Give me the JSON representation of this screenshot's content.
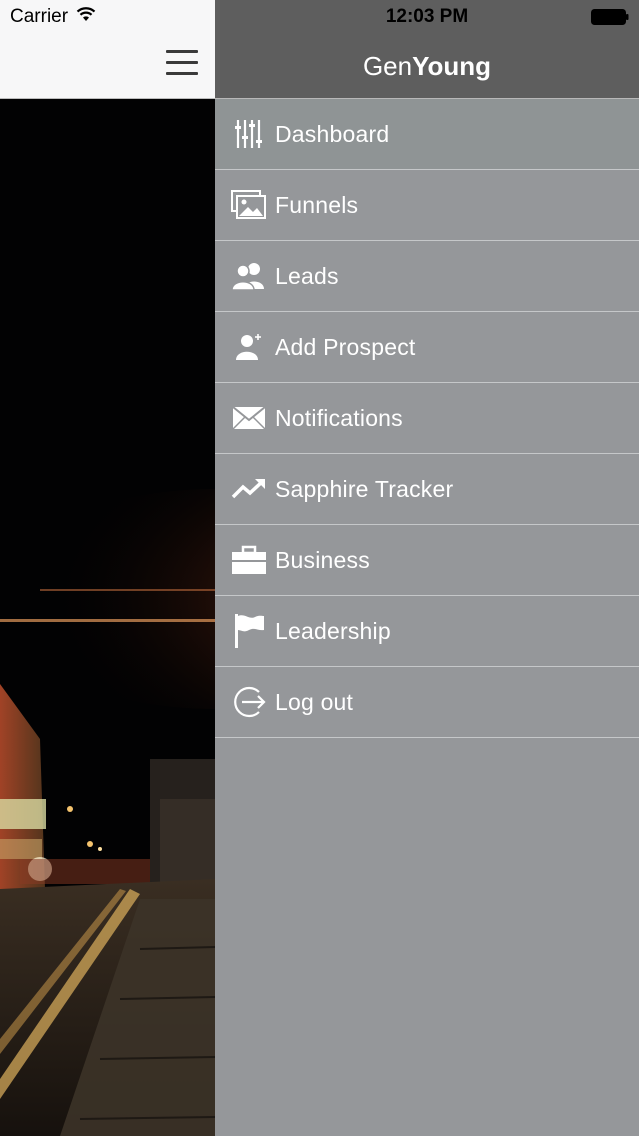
{
  "status_bar": {
    "carrier": "Carrier",
    "time": "12:03 PM",
    "icons": [
      "wifi-icon",
      "battery-icon"
    ]
  },
  "app": {
    "brand_light": "Gen",
    "brand_bold": "Young",
    "menu_icon": "hamburger-menu-icon"
  },
  "menu": {
    "items": [
      {
        "label": "Dashboard",
        "icon": "sliders-icon"
      },
      {
        "label": "Funnels",
        "icon": "images-icon"
      },
      {
        "label": "Leads",
        "icon": "users-icon"
      },
      {
        "label": "Add Prospect",
        "icon": "user-add-icon"
      },
      {
        "label": "Notifications",
        "icon": "envelope-icon"
      },
      {
        "label": "Sapphire Tracker",
        "icon": "trend-up-icon"
      },
      {
        "label": "Business",
        "icon": "briefcase-icon"
      },
      {
        "label": "Leadership",
        "icon": "flag-icon"
      },
      {
        "label": "Log out",
        "icon": "logout-icon"
      }
    ]
  },
  "colors": {
    "menu_background": "#95979a",
    "menu_header": "#5e5e5e",
    "nav_background": "#f7f7f8"
  }
}
